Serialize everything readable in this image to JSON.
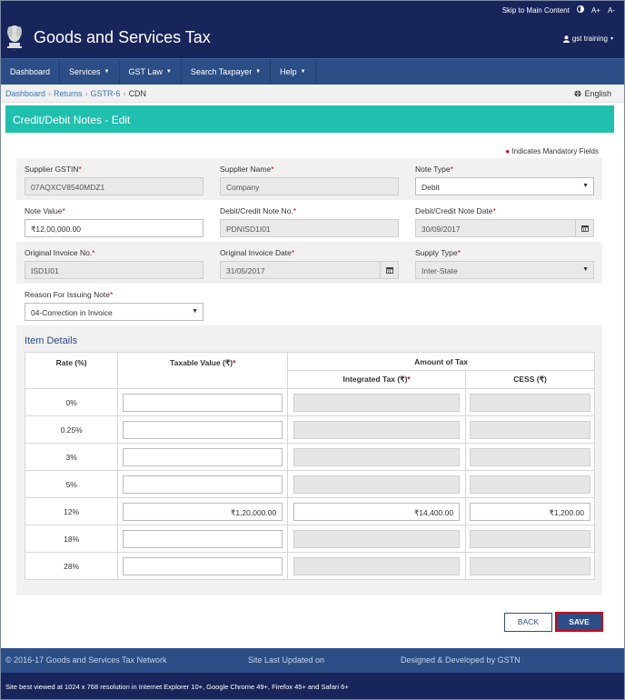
{
  "header": {
    "skip_link": "Skip to Main Content",
    "contrast_icon": "half-circle-icon",
    "font_up": "A+",
    "font_down": "A-",
    "title": "Goods and Services Tax",
    "user": "gst training"
  },
  "nav": {
    "items": [
      {
        "label": "Dashboard",
        "has_menu": false
      },
      {
        "label": "Services",
        "has_menu": true
      },
      {
        "label": "GST Law",
        "has_menu": true
      },
      {
        "label": "Search Taxpayer",
        "has_menu": true
      },
      {
        "label": "Help",
        "has_menu": true
      }
    ]
  },
  "breadcrumb": {
    "items": [
      "Dashboard",
      "Returns",
      "GSTR-6",
      "CDN"
    ],
    "language": "English"
  },
  "page": {
    "heading": "Credit/Debit Notes - Edit",
    "mandatory_note": "Indicates Mandatory Fields"
  },
  "form": {
    "supplier_gstin": {
      "label": "Supplier GSTIN",
      "value": "07AQXCV8540MDZ1"
    },
    "supplier_name": {
      "label": "Supplier Name",
      "value": "Company"
    },
    "note_type": {
      "label": "Note Type",
      "value": "Debit"
    },
    "note_value": {
      "label": "Note Value",
      "value": "₹12,00,000.00"
    },
    "note_no": {
      "label": "Debit/Credit Note No.",
      "value": "PDNISD1I01"
    },
    "note_date": {
      "label": "Debit/Credit Note Date",
      "value": "30/09/2017"
    },
    "orig_invoice_no": {
      "label": "Original Invoice No.",
      "value": "ISD1I01"
    },
    "orig_invoice_date": {
      "label": "Original Invoice Date",
      "value": "31/05/2017"
    },
    "supply_type": {
      "label": "Supply Type",
      "value": "Inter-State"
    },
    "reason": {
      "label": "Reason For Issuing Note",
      "value": "04-Correction in Invoice"
    }
  },
  "items": {
    "title": "Item Details",
    "headers": {
      "rate": "Rate (%)",
      "taxable": "Taxable Value (₹)",
      "amount": "Amount of Tax",
      "igst": "Integrated Tax (₹)",
      "cess": "CESS (₹)"
    },
    "rows": [
      {
        "rate": "0%",
        "taxable": "",
        "igst": "",
        "cess": "",
        "enabled": false
      },
      {
        "rate": "0.25%",
        "taxable": "",
        "igst": "",
        "cess": "",
        "enabled": false
      },
      {
        "rate": "3%",
        "taxable": "",
        "igst": "",
        "cess": "",
        "enabled": false
      },
      {
        "rate": "5%",
        "taxable": "",
        "igst": "",
        "cess": "",
        "enabled": false
      },
      {
        "rate": "12%",
        "taxable": "₹1,20,000.00",
        "igst": "₹14,400.00",
        "cess": "₹1,200.00",
        "enabled": true
      },
      {
        "rate": "18%",
        "taxable": "",
        "igst": "",
        "cess": "",
        "enabled": false
      },
      {
        "rate": "28%",
        "taxable": "",
        "igst": "",
        "cess": "",
        "enabled": false
      }
    ]
  },
  "buttons": {
    "back": "BACK",
    "save": "SAVE"
  },
  "footer": {
    "copyright": "© 2016-17 Goods and Services Tax Network",
    "updated": "Site Last Updated on",
    "designed": "Designed & Developed by GSTN",
    "browser_note": "Site best viewed at 1024 x 768 resolution in Internet Explorer 10+, Google Chrome 49+, Firefox 45+ and Safari 6+"
  },
  "colors": {
    "header_bg": "#17255a",
    "nav_bg": "#2c4e86",
    "card_head": "#1fc0ad",
    "required": "#d0021b"
  }
}
